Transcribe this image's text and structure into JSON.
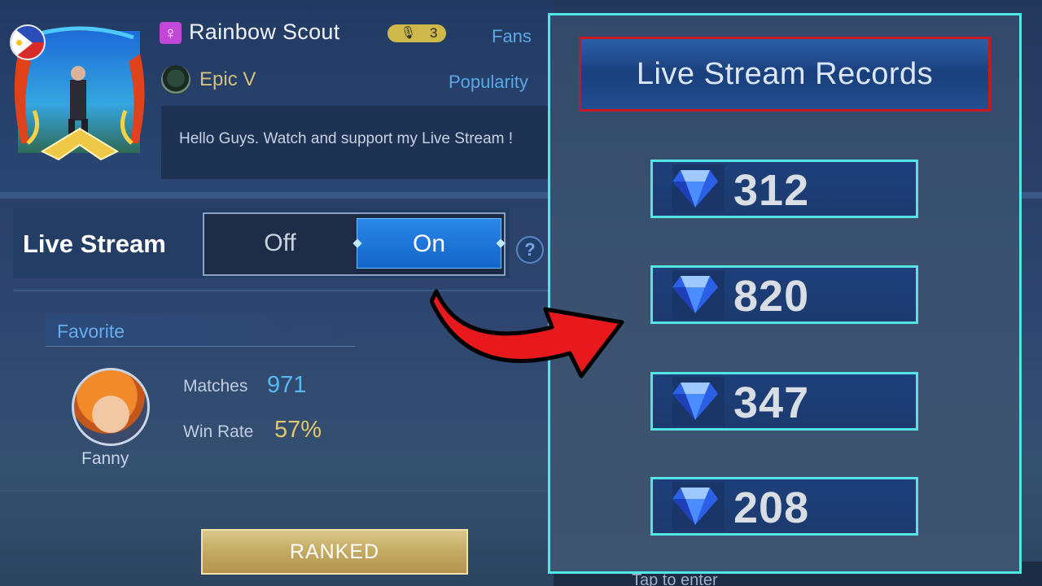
{
  "profile": {
    "name": "Rainbow Scout",
    "mic_count": "3",
    "fans_label": "Fans",
    "rank": "Epic V",
    "popularity_label": "Popularity",
    "bio": "Hello Guys. Watch and support my Live Stream !"
  },
  "live_stream": {
    "label": "Live Stream",
    "off_label": "Off",
    "on_label": "On",
    "help_glyph": "?"
  },
  "favorite": {
    "label": "Favorite",
    "hero_name": "Fanny",
    "matches_label": "Matches",
    "matches_value": "971",
    "winrate_label": "Win Rate",
    "winrate_value": "57%"
  },
  "ranked_button": "RANKED",
  "tap_text": "Tap to enter",
  "records": {
    "title": "Live Stream Records",
    "values": [
      "312",
      "820",
      "347",
      "208"
    ]
  },
  "colors": {
    "accent_cyan": "#4fe6e6",
    "title_border": "#c8181d",
    "arrow_red": "#e8191c",
    "toggle_on": "#1f78e0"
  },
  "icons": {
    "gender": "female-icon",
    "mic": "mic-icon",
    "rank": "rank-emblem-icon",
    "gem": "diamond-icon",
    "help": "help-icon"
  }
}
